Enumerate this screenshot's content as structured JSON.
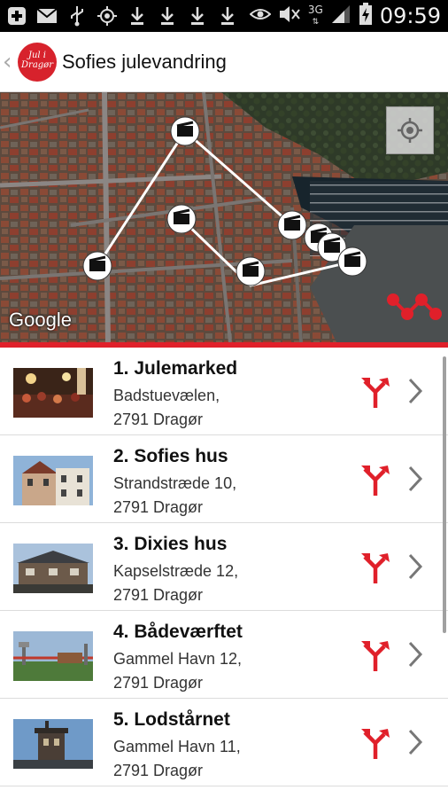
{
  "status_bar": {
    "time": "09:59",
    "network": "3G",
    "left_icons": [
      "add-icon",
      "mail-icon",
      "usb-icon",
      "gps-icon",
      "download-icon",
      "download-icon",
      "download-icon",
      "download-icon"
    ],
    "right_icons": [
      "eye-icon",
      "mute-icon",
      "network-3g-icon",
      "signal-icon",
      "battery-charging-icon"
    ]
  },
  "header": {
    "title": "Sofies julevandring",
    "logo_text": "Jul i Dragør"
  },
  "map": {
    "attribution": "Google"
  },
  "list": {
    "items": [
      {
        "title": "1. Julemarked",
        "address_line1": "Badstuevælen,",
        "address_line2": "2791 Dragør"
      },
      {
        "title": "2. Sofies hus",
        "address_line1": "Strandstræde 10,",
        "address_line2": "2791 Dragør"
      },
      {
        "title": "3. Dixies hus",
        "address_line1": "Kapselstræde 12,",
        "address_line2": "2791 Dragør"
      },
      {
        "title": "4. Bådeværftet",
        "address_line1": "Gammel Havn 12,",
        "address_line2": "2791 Dragør"
      },
      {
        "title": "5. Lodstårnet",
        "address_line1": "Gammel Havn 11,",
        "address_line2": "2791 Dragør"
      }
    ]
  },
  "colors": {
    "accent": "#e0202a",
    "status_bar": "#000000",
    "route_line": "#ffffff"
  }
}
